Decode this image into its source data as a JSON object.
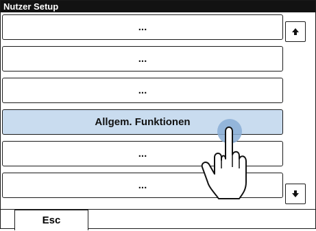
{
  "window": {
    "title": "Nutzer Setup"
  },
  "list": {
    "items": [
      {
        "label": "..."
      },
      {
        "label": "..."
      },
      {
        "label": "..."
      },
      {
        "label": "Allgem. Funktionen",
        "selected": true
      },
      {
        "label": "..."
      },
      {
        "label": "..."
      }
    ]
  },
  "scroll": {
    "up_icon": "arrow-up-icon",
    "down_icon": "arrow-down-icon"
  },
  "footer": {
    "esc_label": "Esc"
  },
  "colors": {
    "titlebar": "#121212",
    "selected_row": "#c9dcef",
    "touch_point": "#8aaed6"
  }
}
